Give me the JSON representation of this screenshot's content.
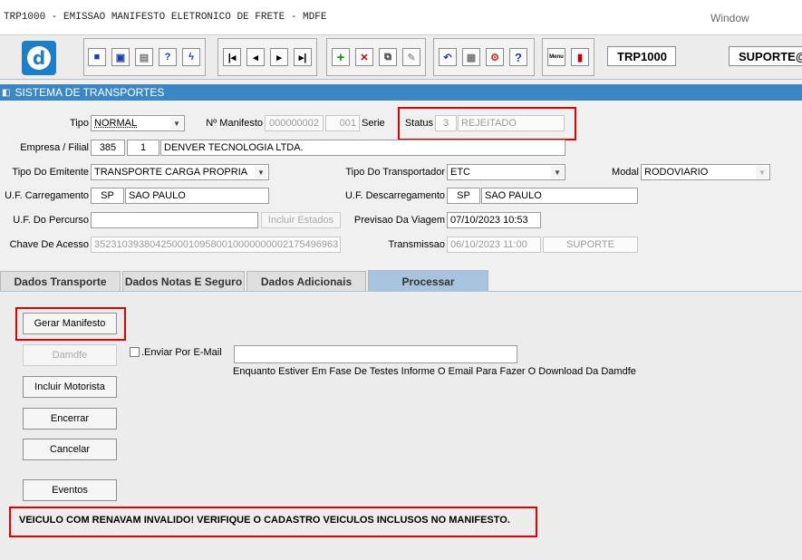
{
  "window": {
    "title": "TRP1000 - EMISSAO MANIFESTO ELETRONICO DE FRETE - MDFE",
    "menu": "Window"
  },
  "toolbar": {
    "logo_letter": "d",
    "buttons": [
      {
        "icon": "save-icon",
        "glyph": "▪"
      },
      {
        "icon": "clear-icon",
        "glyph": "□"
      },
      {
        "icon": "print-icon",
        "glyph": "▤"
      },
      {
        "icon": "query-icon",
        "glyph": "?"
      },
      {
        "icon": "execute-icon",
        "glyph": "ϟ"
      },
      {
        "icon": "first-record-icon",
        "glyph": "⏮"
      },
      {
        "icon": "prev-record-icon",
        "glyph": "◀"
      },
      {
        "icon": "next-record-icon",
        "glyph": "▶"
      },
      {
        "icon": "last-record-icon",
        "glyph": "⏭"
      },
      {
        "icon": "insert-icon",
        "glyph": "+"
      },
      {
        "icon": "delete-icon",
        "glyph": "✕"
      },
      {
        "icon": "duplicate-icon",
        "glyph": "⧉"
      },
      {
        "icon": "edit-icon",
        "glyph": "✎"
      },
      {
        "icon": "undo-icon",
        "glyph": "↶"
      },
      {
        "icon": "list-icon",
        "glyph": "▦"
      },
      {
        "icon": "tools-icon",
        "glyph": "⚙"
      },
      {
        "icon": "help-icon",
        "glyph": "?"
      },
      {
        "icon": "menu-icon",
        "glyph": "▤"
      },
      {
        "icon": "exit-icon",
        "glyph": "▮"
      }
    ],
    "menu_button_text": "Menu",
    "form_code": "TRP1000",
    "user": "SUPORTE@"
  },
  "system_bar": "SISTEMA DE TRANSPORTES",
  "form": {
    "tipo_label": "Tipo",
    "tipo_value": "NORMAL",
    "manifesto_label": "Nº Manifesto",
    "manifesto_value": "000000002",
    "serie_value": "001",
    "serie_label": "Serie",
    "status_label": "Status",
    "status_code": "3",
    "status_text": "REJEITADO",
    "empresa_label": "Empresa / Filial",
    "empresa_code": "385",
    "filial_code": "1",
    "empresa_name": "DENVER TECNOLOGIA LTDA.",
    "tipo_emitente_label": "Tipo Do Emitente",
    "tipo_emitente_value": "TRANSPORTE CARGA PROPRIA",
    "tipo_transportador_label": "Tipo Do Transportador",
    "tipo_transportador_value": "ETC",
    "modal_label": "Modal",
    "modal_value": "RODOVIARIO",
    "uf_carregamento_label": "U.F. Carregamento",
    "uf_carregamento": "SP",
    "uf_carregamento_nome": "SAO PAULO",
    "uf_descarregamento_label": "U.F.  Descarregamento",
    "uf_descarregamento": "SP",
    "uf_descarregamento_nome": "SAO PAULO",
    "uf_percurso_label": "U.F. Do Percurso",
    "uf_percurso_value": "",
    "incluir_estados": "Incluir Estados",
    "previsao_label": "Previsao Da Viagem",
    "previsao_value": "07/10/2023 10:53",
    "chave_label": "Chave De Acesso",
    "chave_value": "35231039380425000109580010000000002175496963",
    "transmissao_label": "Transmissao",
    "transmissao_data": "06/10/2023 11:00",
    "transmissao_user": "SUPORTE"
  },
  "tabs": [
    "Dados Transporte",
    "Dados Notas E Seguro",
    "Dados Adicionais",
    "Processar"
  ],
  "processar": {
    "gerar_manifesto": "Gerar Manifesto",
    "damdfe": "Damdfe",
    "enviar_email_label": ".Enviar Por E-Mail",
    "email_value": "",
    "email_hint": "Enquanto Estiver Em Fase De Testes Informe O Email Para Fazer O Download Da Damdfe",
    "incluir_motorista": "Incluir Motorista",
    "encerrar": "Encerrar",
    "cancelar": "Cancelar",
    "eventos": "Eventos",
    "error_message": "VEICULO COM RENAVAM INVALIDO! VERIFIQUE O CADASTRO VEICULOS INCLUSOS NO MANIFESTO."
  }
}
